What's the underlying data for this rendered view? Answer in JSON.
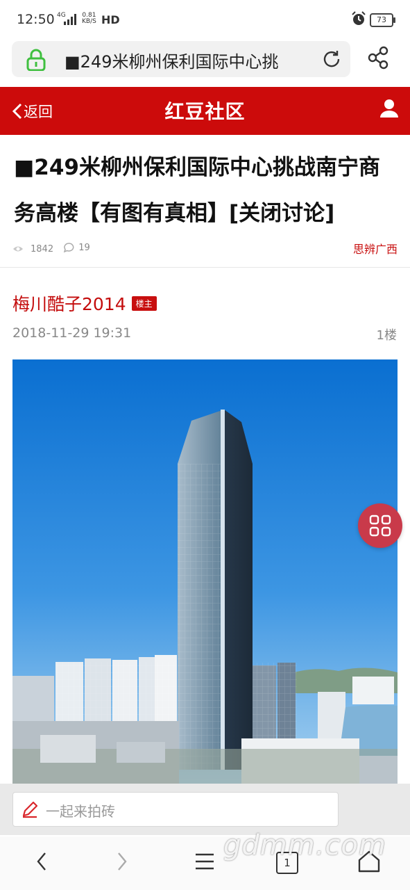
{
  "status_bar": {
    "time": "12:50",
    "network": "4G",
    "speed_value": "0.81",
    "speed_unit": "KB/S",
    "hd": "HD",
    "battery": "73"
  },
  "address_bar": {
    "url_text": "■249米柳州保利国际中心挑"
  },
  "header": {
    "back_label": "返回",
    "logo_text": "红豆社区",
    "brand_color": "#cc0b0b"
  },
  "thread": {
    "title": "■249米柳州保利国际中心挑战南宁商务高楼【有图有真相】[关闭讨论]",
    "views": "1842",
    "replies": "19",
    "board": "思辨广西"
  },
  "post": {
    "author": "梅川酷子2014",
    "badge": "楼主",
    "time": "2018-11-29 19:31",
    "floor": "1楼"
  },
  "reply_bar": {
    "placeholder": "一起来拍砖"
  },
  "nav": {
    "tab_count": "1"
  },
  "watermark": "gdmm.com",
  "icons": [
    "lock-icon",
    "reload-icon",
    "share-icon",
    "back-chevron-icon",
    "user-icon",
    "eye-icon",
    "comment-icon",
    "grid-menu-icon",
    "pencil-icon",
    "nav-back-icon",
    "nav-forward-icon",
    "menu-icon",
    "tabs-icon",
    "home-icon"
  ]
}
